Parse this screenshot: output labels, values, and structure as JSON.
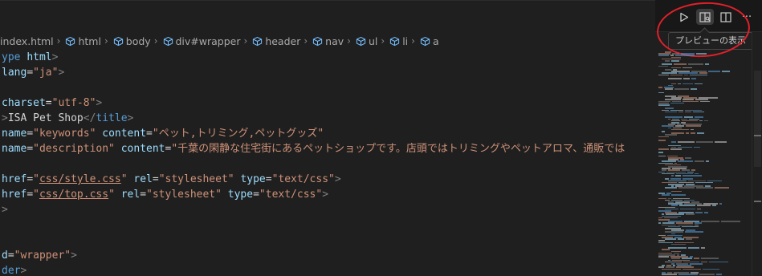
{
  "breadcrumb": [
    {
      "label": "index.html",
      "icon": "file-icon"
    },
    {
      "label": "html",
      "icon": "element-cube-icon"
    },
    {
      "label": "body",
      "icon": "element-cube-icon"
    },
    {
      "label": "div#wrapper",
      "icon": "element-cube-icon"
    },
    {
      "label": "header",
      "icon": "element-cube-icon"
    },
    {
      "label": "nav",
      "icon": "element-cube-icon"
    },
    {
      "label": "ul",
      "icon": "element-cube-icon"
    },
    {
      "label": "li",
      "icon": "element-cube-icon"
    },
    {
      "label": "a",
      "icon": "element-cube-icon"
    }
  ],
  "editor_actions": {
    "run": {
      "icon": "run-icon"
    },
    "preview": {
      "icon": "open-preview-icon"
    },
    "split": {
      "icon": "split-editor-icon"
    },
    "more": {
      "icon": "more-actions-icon",
      "label": "···"
    }
  },
  "tooltip": {
    "text": "プレビューの表示"
  },
  "code_lines": [
    [
      {
        "t": "ype ",
        "c": "tag"
      },
      {
        "t": "html",
        "c": "attr"
      },
      {
        "t": ">",
        "c": "punc"
      }
    ],
    [
      {
        "t": "lang",
        "c": "attr"
      },
      {
        "t": "=",
        "c": "txt"
      },
      {
        "t": "\"ja\"",
        "c": "str"
      },
      {
        "t": ">",
        "c": "punc"
      }
    ],
    [],
    [
      {
        "t": "charset",
        "c": "attr"
      },
      {
        "t": "=",
        "c": "txt"
      },
      {
        "t": "\"utf-8\"",
        "c": "str"
      },
      {
        "t": ">",
        "c": "punc"
      }
    ],
    [
      {
        "t": ">",
        "c": "punc"
      },
      {
        "t": "ISA Pet Shop",
        "c": "txt"
      },
      {
        "t": "</",
        "c": "punc"
      },
      {
        "t": "title",
        "c": "tag"
      },
      {
        "t": ">",
        "c": "punc"
      }
    ],
    [
      {
        "t": "name",
        "c": "attr"
      },
      {
        "t": "=",
        "c": "txt"
      },
      {
        "t": "\"keywords\"",
        "c": "str"
      },
      {
        "t": " ",
        "c": "txt"
      },
      {
        "t": "content",
        "c": "attr"
      },
      {
        "t": "=",
        "c": "txt"
      },
      {
        "t": "\"ペット,トリミング,ペットグッズ\"",
        "c": "str"
      }
    ],
    [
      {
        "t": "name",
        "c": "attr"
      },
      {
        "t": "=",
        "c": "txt"
      },
      {
        "t": "\"description\"",
        "c": "str"
      },
      {
        "t": " ",
        "c": "txt"
      },
      {
        "t": "content",
        "c": "attr"
      },
      {
        "t": "=",
        "c": "txt"
      },
      {
        "t": "\"千葉の閑静な住宅街にあるペットショップです。店頭ではトリミングやペットアロマ、通販では",
        "c": "str"
      }
    ],
    [],
    [
      {
        "t": "href",
        "c": "attr"
      },
      {
        "t": "=",
        "c": "txt"
      },
      {
        "t": "\"",
        "c": "str"
      },
      {
        "t": "css/style.css",
        "c": "str ul"
      },
      {
        "t": "\"",
        "c": "str"
      },
      {
        "t": " ",
        "c": "txt"
      },
      {
        "t": "rel",
        "c": "attr"
      },
      {
        "t": "=",
        "c": "txt"
      },
      {
        "t": "\"stylesheet\"",
        "c": "str"
      },
      {
        "t": " ",
        "c": "txt"
      },
      {
        "t": "type",
        "c": "attr"
      },
      {
        "t": "=",
        "c": "txt"
      },
      {
        "t": "\"text/css\"",
        "c": "str"
      },
      {
        "t": ">",
        "c": "punc"
      }
    ],
    [
      {
        "t": "href",
        "c": "attr"
      },
      {
        "t": "=",
        "c": "txt"
      },
      {
        "t": "\"",
        "c": "str"
      },
      {
        "t": "css/top.css",
        "c": "str ul"
      },
      {
        "t": "\"",
        "c": "str"
      },
      {
        "t": " ",
        "c": "txt"
      },
      {
        "t": "rel",
        "c": "attr"
      },
      {
        "t": "=",
        "c": "txt"
      },
      {
        "t": "\"stylesheet\"",
        "c": "str"
      },
      {
        "t": " ",
        "c": "txt"
      },
      {
        "t": "type",
        "c": "attr"
      },
      {
        "t": "=",
        "c": "txt"
      },
      {
        "t": "\"text/css\"",
        "c": "str"
      },
      {
        "t": ">",
        "c": "punc"
      }
    ],
    [
      {
        "t": ">",
        "c": "punc"
      }
    ],
    [],
    [],
    [
      {
        "t": "d",
        "c": "attr"
      },
      {
        "t": "=",
        "c": "txt"
      },
      {
        "t": "\"wrapper\"",
        "c": "str"
      },
      {
        "t": ">",
        "c": "punc"
      }
    ],
    [
      {
        "t": "der",
        "c": "tag"
      },
      {
        "t": ">",
        "c": "punc"
      }
    ]
  ]
}
